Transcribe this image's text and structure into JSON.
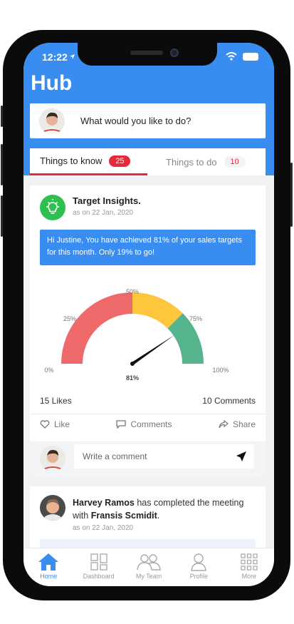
{
  "status": {
    "time": "12:22",
    "icons": [
      "location-arrow-icon",
      "wifi-icon",
      "battery-icon"
    ]
  },
  "header": {
    "title": "Hub",
    "ask_prompt": "What would you like to do?"
  },
  "tabs": [
    {
      "label": "Things to know",
      "count": "25",
      "active": true
    },
    {
      "label": "Things to do",
      "count": "10",
      "active": false
    }
  ],
  "insight_card": {
    "title": "Target Insights.",
    "date": "as on 22 Jan, 2020",
    "message": "Hi Justine, You have achieved 81% of your sales targets for this month. Only 19% to go!",
    "gauge": {
      "labels": [
        "0%",
        "25%",
        "50%",
        "75%",
        "100%"
      ],
      "value_label": "81%",
      "value": 81,
      "colors": {
        "low": "#ee6a6a",
        "mid": "#fec63c",
        "high": "#55b48c"
      }
    },
    "likes": "15 Likes",
    "comments": "10 Comments",
    "actions": {
      "like": "Like",
      "comment": "Comments",
      "share": "Share"
    },
    "comment_placeholder": "Write a comment"
  },
  "meeting_card": {
    "person": "Harvey Ramos",
    "text": "has completed the meeting with",
    "with": "Fransis Scmidit",
    "date": "as on 22 Jan, 2020"
  },
  "bottom_nav": [
    {
      "label": "Home",
      "icon": "home-icon",
      "active": true
    },
    {
      "label": "Dashboard",
      "icon": "dashboard-icon",
      "active": false
    },
    {
      "label": "My Team",
      "icon": "team-icon",
      "active": false
    },
    {
      "label": "Profile",
      "icon": "profile-icon",
      "active": false
    },
    {
      "label": "More",
      "icon": "grid-icon",
      "active": false
    }
  ],
  "colors": {
    "accent": "#3a8df0",
    "badge_red": "#e8293b",
    "insight_green": "#2ec04f"
  }
}
